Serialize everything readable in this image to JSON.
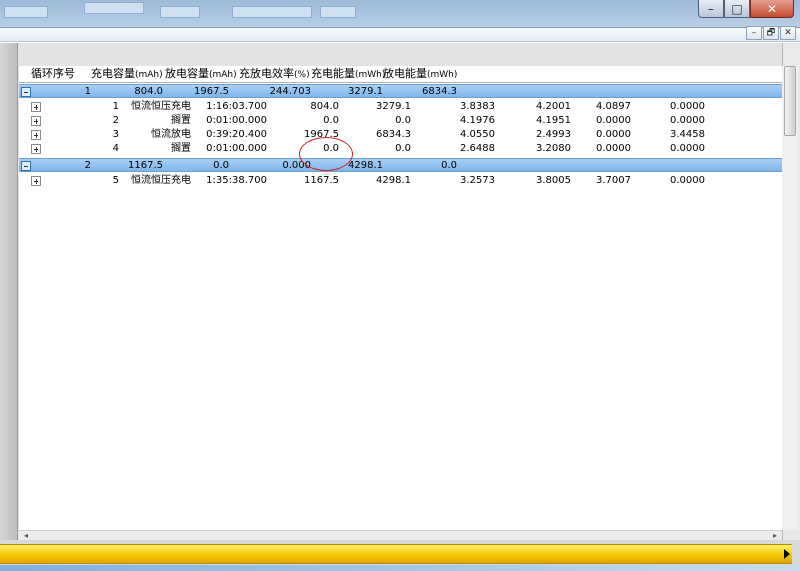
{
  "window": {
    "minimize_glyph": "–",
    "maximize_glyph": "□",
    "close_glyph": "✕"
  },
  "mdi": {
    "minimize_glyph": "–",
    "restore_glyph": "🗗",
    "close_glyph": "✕"
  },
  "grid": {
    "headers": {
      "cycle_no": "循环序号",
      "charge_cap": "充电容量",
      "charge_cap_unit": "(mAh)",
      "discharge_cap": "放电容量",
      "discharge_cap_unit": "(mAh)",
      "efficiency": "充放电效率",
      "efficiency_unit": "(%)",
      "charge_energy": "充电能量",
      "charge_energy_unit": "(mWh)",
      "discharge_energy": "放电能量",
      "discharge_energy_unit": "(mWh)"
    },
    "cycles": [
      {
        "cycle": "1",
        "charge_cap": "804.0",
        "discharge_cap": "1967.5",
        "efficiency": "244.703",
        "charge_energy": "3279.1",
        "discharge_energy": "6834.3",
        "steps": [
          {
            "no": "1",
            "name": "恒流恒压充电",
            "time": "1:16:03.700",
            "cap": "804.0",
            "energy": "3279.1",
            "v1": "3.8383",
            "v2": "4.2001",
            "v3": "4.0897",
            "v4": "0.0000"
          },
          {
            "no": "2",
            "name": "搁置",
            "time": "0:01:00.000",
            "cap": "0.0",
            "energy": "0.0",
            "v1": "4.1976",
            "v2": "4.1951",
            "v3": "0.0000",
            "v4": "0.0000"
          },
          {
            "no": "3",
            "name": "恒流放电",
            "time": "0:39:20.400",
            "cap": "1967.5",
            "energy": "6834.3",
            "v1": "4.0550",
            "v2": "2.4993",
            "v3": "0.0000",
            "v4": "3.4458"
          },
          {
            "no": "4",
            "name": "搁置",
            "time": "0:01:00.000",
            "cap": "0.0",
            "energy": "0.0",
            "v1": "2.6488",
            "v2": "3.2080",
            "v3": "0.0000",
            "v4": "0.0000"
          }
        ]
      },
      {
        "cycle": "2",
        "charge_cap": "1167.5",
        "discharge_cap": "0.0",
        "efficiency": "0.000",
        "charge_energy": "4298.1",
        "discharge_energy": "0.0",
        "steps": [
          {
            "no": "5",
            "name": "恒流恒压充电",
            "time": "1:35:38.700",
            "cap": "1167.5",
            "energy": "4298.1",
            "v1": "3.2573",
            "v2": "3.8005",
            "v3": "3.7007",
            "v4": "0.0000"
          }
        ]
      }
    ]
  },
  "scroll": {
    "left_arrow": "◂",
    "right_arrow": "▸"
  }
}
